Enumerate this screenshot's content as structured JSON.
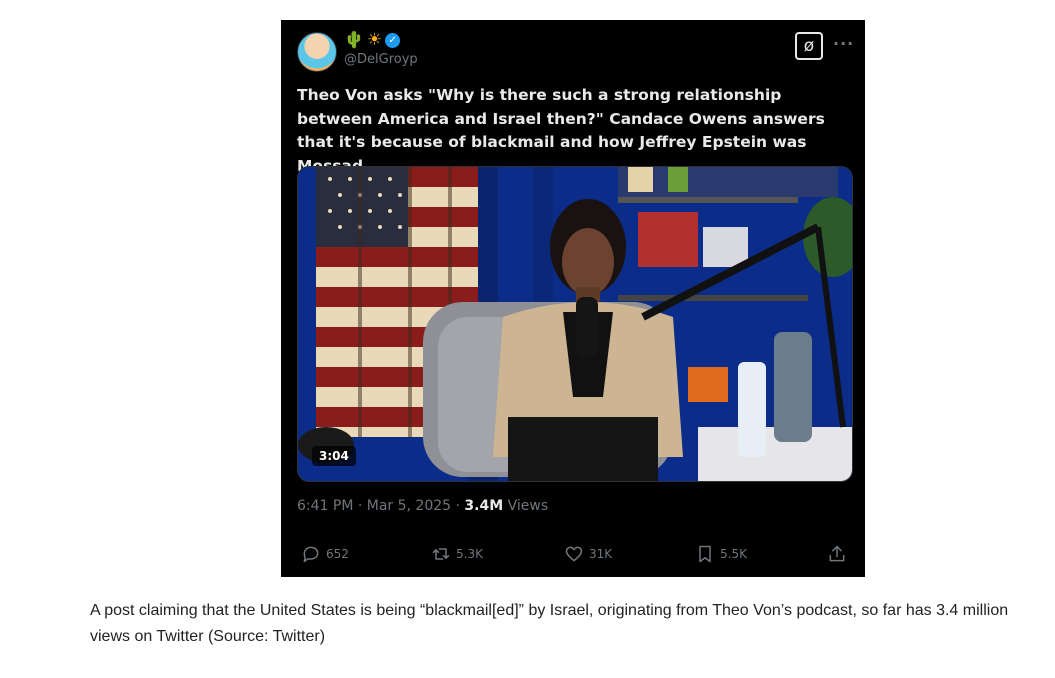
{
  "tweet": {
    "display_name_emojis": [
      "🌵",
      "☀"
    ],
    "handle": "@DelGroyp",
    "text": "Theo Von asks \"Why is there such a strong relationship between America and Israel then?\" Candace Owens answers that it's because of blackmail and how Jeffrey Epstein was Mossad.",
    "video_duration": "3:04",
    "time": "6:41 PM · Mar 5, 2025 · ",
    "views_count": "3.4M",
    "views_label": " Views",
    "replies": "652",
    "reposts": "5.3K",
    "likes": "31K",
    "bookmarks": "5.5K",
    "grok_glyph": "ø",
    "more_glyph": "···",
    "verified_glyph": "✓"
  },
  "caption": "A post claiming that the United States is being “blackmail[ed]” by Israel, originating from Theo Von’s podcast, so far has 3.4 million views on Twitter (Source: Twitter)",
  "colors": {
    "card_bg": "#000000",
    "text_primary": "#e7e9ea",
    "text_secondary": "#71767b",
    "verified_blue": "#1d9bf0"
  },
  "icons": [
    "avatar",
    "cactus-emoji",
    "sun-emoji",
    "verified-badge-icon",
    "grok-icon",
    "more-icon",
    "reply-icon",
    "repost-icon",
    "like-icon",
    "bookmark-icon",
    "share-icon"
  ]
}
